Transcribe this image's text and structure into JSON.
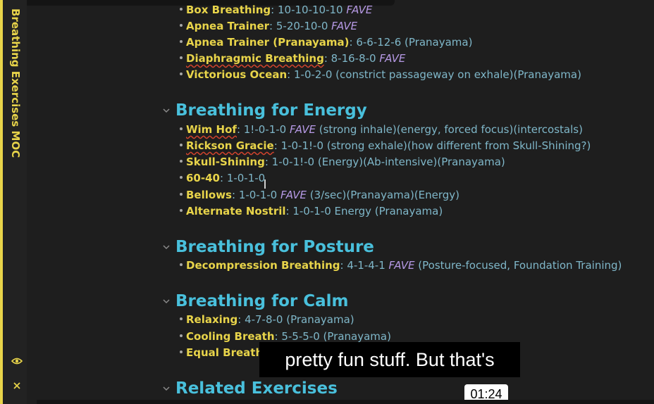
{
  "sidebar": {
    "title": "Breathing Exercises MOC"
  },
  "sections": [
    {
      "heading": "",
      "items": [
        {
          "name": "Box Breathing",
          "sep": ": ",
          "pattern": "10-10-10-10 ",
          "fave": "FAVE",
          "note": ""
        },
        {
          "name": "Apnea Trainer",
          "sep": ": ",
          "pattern": "5-20-10-0 ",
          "fave": "FAVE",
          "note": ""
        },
        {
          "name": "Apnea Trainer (Pranayama)",
          "sep": ": ",
          "pattern": "6-6-12-6 (Pranayama)",
          "fave": "",
          "note": ""
        },
        {
          "name": "Diaphragmic Breathing",
          "sep": ": ",
          "pattern": "8-16-8-0 ",
          "fave": "FAVE",
          "note": ""
        },
        {
          "name": "Victorious Ocean",
          "sep": ": ",
          "pattern": "1-0-2-0 (constrict passageway on exhale)(Pranayama)",
          "fave": "",
          "note": ""
        }
      ]
    },
    {
      "heading": "Breathing for Energy",
      "items": [
        {
          "name": "Wim Hof",
          "sep": ": ",
          "pattern": "1!-0-1-0 ",
          "fave": "FAVE",
          "note": " (strong inhale)(energy, forced focus)(intercostals)"
        },
        {
          "name": "Rickson Gracie",
          "sep": ": ",
          "pattern": "1-0-1!-0 (strong exhale)(how different from Skull-Shining?)",
          "fave": "",
          "note": ""
        },
        {
          "name": "Skull-Shining",
          "sep": ": ",
          "pattern": "1-0-1!-0 (Energy)(Ab-intensive)(Pranayama)",
          "fave": "",
          "note": ""
        },
        {
          "name": "60-40",
          "sep": ": ",
          "pattern": "1-0-1-0",
          "fave": "",
          "note": ""
        },
        {
          "name": "Bellows",
          "sep": ": ",
          "pattern": "1-0-1-0 ",
          "fave": "FAVE",
          "note": " (3/sec)(Pranayama)(Energy)"
        },
        {
          "name": "Alternate Nostril",
          "sep": ": ",
          "pattern": "1-0-1-0 Energy (Pranayama)",
          "fave": "",
          "note": ""
        }
      ]
    },
    {
      "heading": "Breathing for Posture",
      "items": [
        {
          "name": "Decompression Breathing",
          "sep": ": ",
          "pattern": "4-1-4-1 ",
          "fave": "FAVE",
          "note": " (Posture-focused, Foundation Training)"
        }
      ]
    },
    {
      "heading": "Breathing for Calm",
      "items": [
        {
          "name": "Relaxing",
          "sep": ": ",
          "pattern": "4-7-8-0 (Pranayama)",
          "fave": "",
          "note": ""
        },
        {
          "name": "Cooling Breath",
          "sep": ": ",
          "pattern": "5-5-5-0 (Pranayama)",
          "fave": "",
          "note": ""
        },
        {
          "name": "Equal Breath",
          "sep": ":",
          "pattern": "",
          "fave": "",
          "note": ""
        }
      ]
    },
    {
      "heading": "Related Exercises",
      "items": []
    }
  ],
  "video": {
    "caption": "pretty fun stuff. But that's",
    "timestamp": "01:24"
  },
  "colors": {
    "accent": "#e8d44a",
    "heading": "#49c0dc",
    "text": "#7fb7c9",
    "fave": "#b79ae6"
  },
  "icons": {
    "preview": "eye-icon",
    "close": "close-icon",
    "fold": "chevron-down-icon"
  }
}
